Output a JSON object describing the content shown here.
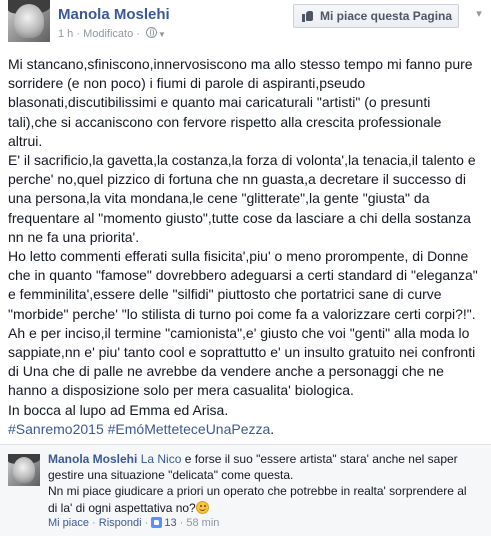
{
  "post": {
    "author": "Manola Moslehi",
    "meta": {
      "time": "1 h",
      "separator": "·",
      "edited": "Modificato",
      "separator2": "·"
    },
    "like_page_label": "Mi piace questa Pagina",
    "body_lines": [
      "Mi stancano,sfiniscono,innervosiscono ma allo stesso tempo mi fanno pure",
      "sorridere (e non poco) i fiumi di parole di aspiranti,pseudo",
      "blasonati,discutibilissimi e quanto mai caricaturali \"artisti\" (o presunti",
      "tali),che si accaniscono con fervore rispetto alla crescita professionale",
      "altrui.",
      "E' il sacrificio,la gavetta,la costanza,la forza di volonta',la tenacia,il talento e",
      "perche' no,quel pizzico di fortuna che nn guasta,a decretare il successo di",
      "una persona,la vita mondana,le cene \"glitterate\",la gente \"giusta\" da",
      "frequentare al \"momento giusto\",tutte cose da lasciare a chi della sostanza",
      "nn ne fa una priorita'.",
      "Ho letto commenti efferati sulla fisicita',piu' o meno prorompente, di Donne",
      "che in quanto \"famose\" dovrebbero adeguarsi a certi standard di \"eleganza\"",
      "e femminilita',essere delle \"silfidi\" piuttosto che portatrici sane di curve",
      "\"morbide\" perche' \"lo stilista di turno poi come fa a valorizzare certi corpi?!\".",
      "Ah e per inciso,il termine \"camionista\",e' giusto che voi \"genti\" alla moda lo",
      "sappiate,nn e' piu' tanto cool e soprattutto e' un insulto gratuito nei confronti",
      "di Una che di palle ne avrebbe da vendere anche a personaggi che ne",
      "hanno a disposizione solo per mera casualita' biologica.",
      "In bocca al lupo ad Emma ed Arisa."
    ],
    "hashtags": [
      "#Sanremo2015",
      "#EmóMetteteceUnaPezza"
    ],
    "hashtag_end": "."
  },
  "comment": {
    "author": "Manola Moslehi",
    "tagged": "La Nico",
    "line1_rest": " e forse il suo \"essere artista\" stara' anche nel saper",
    "line2": "gestire una situazione \"delicata\" come questa.",
    "line3": "Nn mi piace giudicare a priori un operato che potrebbe in realta' sorprendere al",
    "line4": "di la' di ogni aspettativa no?",
    "actions": {
      "like": "Mi piace",
      "sep1": " · ",
      "reply": "Rispondi",
      "sep2": " · ",
      "likes_count": "13",
      "sep3": " · ",
      "time": "58 min"
    }
  },
  "colors": {
    "link": "#3b5998",
    "text": "#141823",
    "meta": "#9197a3",
    "comment_bg": "#f6f7f8"
  },
  "icons": {
    "like_button": "thumbs-up-icon",
    "audience": "globe-icon",
    "menu": "chevron-down-icon",
    "emoji": "smiley-icon",
    "like_count": "like-count-icon"
  }
}
